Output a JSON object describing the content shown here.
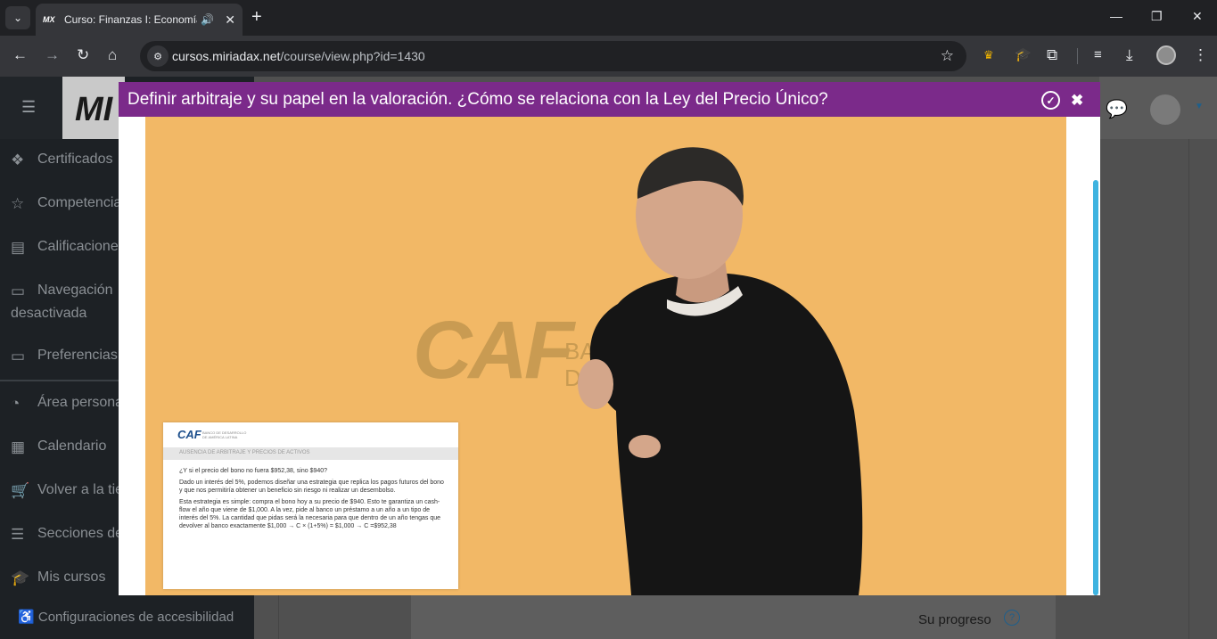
{
  "browser": {
    "tab": {
      "favicon": "MX",
      "title": "Curso: Finanzas I: Economía",
      "audio_icon": "speaker-icon",
      "close_icon": "close-icon"
    },
    "new_tab_icon": "plus-icon",
    "window_controls": [
      "minimize-icon",
      "restore-icon",
      "close-icon"
    ],
    "nav": [
      "back-icon",
      "forward-icon",
      "reload-icon",
      "home-icon"
    ],
    "url_host": "cursos.miriadax.net",
    "url_path": "/course/view.php?id=1430",
    "extensions": [
      "crown-icon",
      "graduation-cap-icon",
      "puzzle-icon",
      "media-control-icon",
      "download-icon",
      "profile-icon",
      "menu-dots-icon"
    ]
  },
  "drawer": {
    "logo": "MI",
    "items": [
      {
        "label": "Certificados",
        "icon": "layers-icon"
      },
      {
        "label": "Competencias",
        "icon": "star-icon"
      },
      {
        "label": "Calificaciones",
        "icon": "gradebook-icon"
      },
      {
        "label": "Navegación",
        "label2": "desactivada",
        "icon": "folder-icon"
      },
      {
        "label": "Preferencias",
        "icon": "folder-icon"
      },
      {
        "label": "Área personal",
        "icon": "dashboard-icon"
      },
      {
        "label": "Calendario",
        "icon": "calendar-icon"
      },
      {
        "label": "Volver a la tienda",
        "icon": "cart-icon"
      },
      {
        "label": "Secciones del curso",
        "icon": "list-icon"
      },
      {
        "label": "Mis cursos",
        "icon": "mortarboard-icon"
      }
    ],
    "accessibility": "Configuraciones de accesibilidad"
  },
  "page": {
    "progress_label": "Su progreso",
    "help_icon": "?"
  },
  "modal": {
    "title": "Definir arbitraje y su papel en la valoración. ¿Cómo se relaciona con la Ley del Precio Único?",
    "check_icon": "check-circle-icon",
    "close_icon": "close-icon"
  },
  "video": {
    "backdrop_logo": "CAF",
    "backdrop_side": [
      "BAN",
      "DE"
    ],
    "slide": {
      "logo": "CAF",
      "logo_sub": [
        "BANCO DE DESARROLLO",
        "DE AMÉRICA LATINA"
      ],
      "heading": "AUSENCIA DE ARBITRAJE Y PRECIOS DE ACTIVOS",
      "p1": "¿Y si el precio del bono no fuera $952,38, sino $940?",
      "p2": "Dado un interés del 5%, podemos diseñar una estrategia que replica los pagos futuros del bono y que nos permitiría obtener un beneficio sin riesgo ni realizar un desembolso.",
      "p3": "Esta estrategia es simple: compra el bono hoy a su precio de $940. Esto te garantiza un cash-flow el año que viene de $1,000. A la vez, pide al banco un préstamo a un año a un tipo de interés del 5%. La cantidad que pidas será la necesaria para que dentro de un año tengas que devolver al banco exactamente $1,000 → C × (1+5%) = $1,000 → C =$952,38"
    }
  },
  "colors": {
    "modal_header": "#7b2a8a",
    "video_bg": "#f2b866",
    "scrollbar": "#3eb3e0"
  }
}
